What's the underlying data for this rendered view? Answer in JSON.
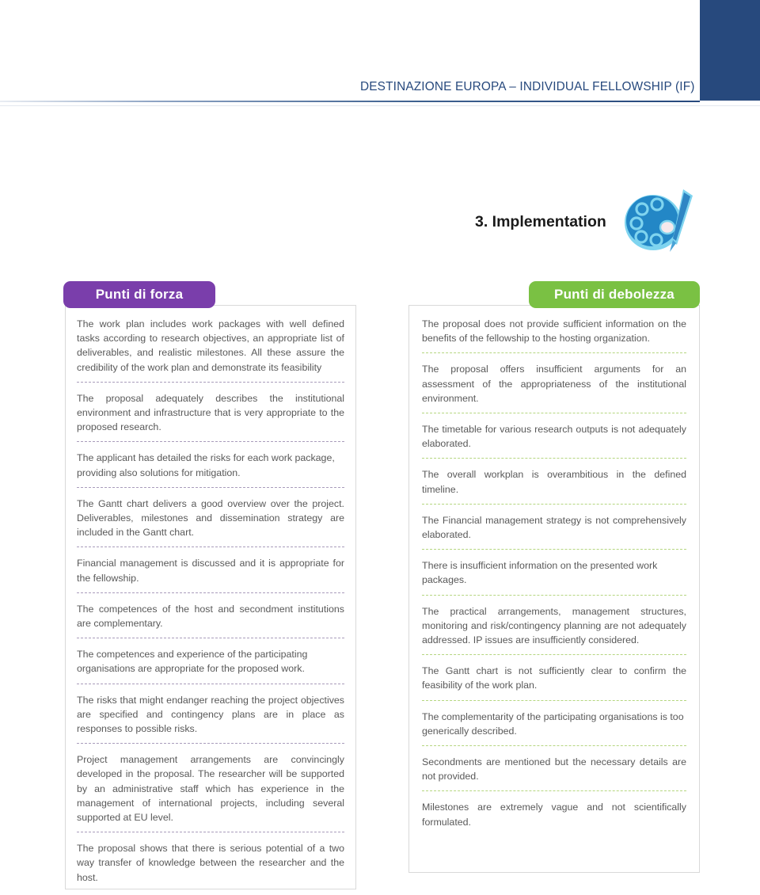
{
  "header": {
    "title": "DESTINAZIONE EUROPA – INDIVIDUAL FELLOWSHIP (IF)",
    "accent_color": "#27497d"
  },
  "section": {
    "title": "3. Implementation",
    "icon": "palette-icon"
  },
  "strengths": {
    "badge_label": "Punti di forza",
    "badge_color": "#7a3eab",
    "separator_color": "#9b8bb0",
    "items": [
      "The work plan includes work packages with well defined tasks according to research objectives, an appropriate list of deliverables, and realistic milestones. All these assure the credibility of the work plan and demonstrate its feasibility",
      "The proposal adequately describes the institutional environment and infrastructure that is very appropriate to the proposed research.",
      "The applicant has detailed the risks for each work package, providing also solutions for mitigation.",
      "The Gantt chart delivers a good overview over the project. Deliverables, milestones and dissemination strategy are included in the Gantt chart.",
      "Financial management is discussed and it is appropriate for the fellowship.",
      "The competences of the host and secondment institutions are complementary.",
      "The competences and experience of the participating organisations are appropriate for the proposed work.",
      "The risks that might endanger reaching the project objectives are specified and contingency plans are in place as responses to possible risks.",
      "Project management arrangements are convincingly developed in the proposal. The researcher will be supported by an administrative staff which has experience in the management of international projects, including several supported at EU level.",
      "The proposal shows that there is serious potential of a two way transfer of knowledge between the researcher and the host."
    ]
  },
  "weaknesses": {
    "badge_label": "Punti di debolezza",
    "badge_color": "#7ac143",
    "separator_color": "#a9cf6a",
    "items": [
      "The proposal does not provide sufficient information on the benefits of the fellowship to the hosting organization.",
      "The proposal offers insufficient arguments for an assessment of the appropriateness of the institutional environment.",
      "The timetable for various research outputs is not adequately elaborated.",
      "The overall workplan is overambitious in the defined timeline.",
      "The Financial management strategy is not comprehensively elaborated.",
      "There is insufficient information on the presented work packages.",
      "The practical arrangements, management structures, monitoring and risk/contingency planning are not adequately addressed. IP issues are insufficiently considered.",
      "The Gantt chart is not sufficiently clear to confirm the feasibility of the work plan.",
      "The complementarity of the participating organisations is too generically described.",
      "Secondments are mentioned but the necessary details are not provided.",
      "Milestones are extremely vague and not scientifically formulated."
    ]
  }
}
